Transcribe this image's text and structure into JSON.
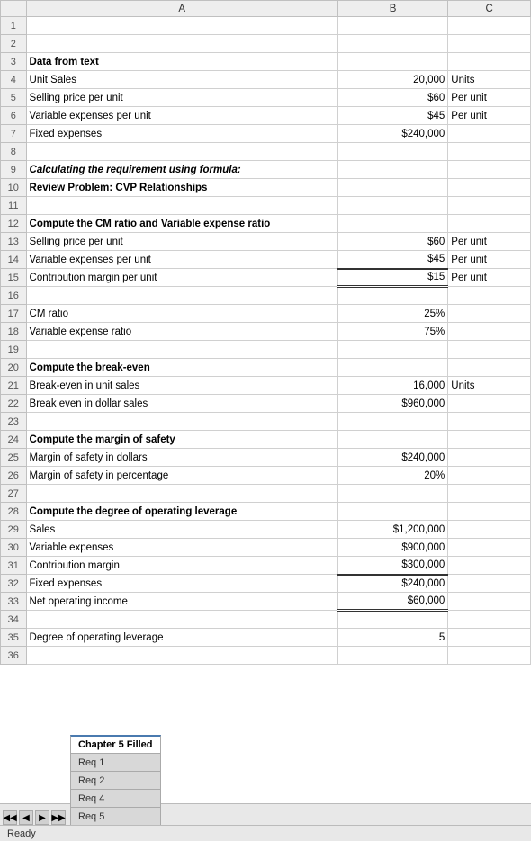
{
  "columns": [
    "",
    "A",
    "B",
    "C"
  ],
  "tabs": [
    {
      "label": "Chapter 5 Filled",
      "active": true
    },
    {
      "label": "Req 1",
      "active": false
    },
    {
      "label": "Req 2",
      "active": false
    },
    {
      "label": "Req 4",
      "active": false
    },
    {
      "label": "Req 5",
      "active": false
    }
  ],
  "status": "Ready",
  "rows": [
    {
      "num": "1",
      "a": "",
      "b": "",
      "c": "",
      "style_a": "",
      "style_b": "",
      "style_c": ""
    },
    {
      "num": "2",
      "a": "",
      "b": "",
      "c": "",
      "style_a": "",
      "style_b": "",
      "style_c": ""
    },
    {
      "num": "3",
      "a": "Data from text",
      "b": "",
      "c": "",
      "style_a": "cell-bold",
      "style_b": "",
      "style_c": ""
    },
    {
      "num": "4",
      "a": "Unit Sales",
      "b": "20,000",
      "c": "Units",
      "style_a": "",
      "style_b": "cell-right",
      "style_c": ""
    },
    {
      "num": "5",
      "a": "Selling price per unit",
      "b": "$60",
      "c": "Per unit",
      "style_a": "",
      "style_b": "cell-right",
      "style_c": ""
    },
    {
      "num": "6",
      "a": "Variable expenses per unit",
      "b": "$45",
      "c": "Per unit",
      "style_a": "",
      "style_b": "cell-right",
      "style_c": ""
    },
    {
      "num": "7",
      "a": "Fixed expenses",
      "b": "$240,000",
      "c": "",
      "style_a": "",
      "style_b": "cell-right",
      "style_c": ""
    },
    {
      "num": "8",
      "a": "",
      "b": "",
      "c": "",
      "style_a": "",
      "style_b": "",
      "style_c": ""
    },
    {
      "num": "9",
      "a": "Calculating the requirement using formula:",
      "b": "",
      "c": "",
      "style_a": "cell-bold-italic",
      "style_b": "",
      "style_c": ""
    },
    {
      "num": "10",
      "a": "Review Problem: CVP Relationships",
      "b": "",
      "c": "",
      "style_a": "cell-bold",
      "style_b": "",
      "style_c": ""
    },
    {
      "num": "11",
      "a": "",
      "b": "",
      "c": "",
      "style_a": "",
      "style_b": "",
      "style_c": ""
    },
    {
      "num": "12",
      "a": "Compute the CM ratio and Variable expense ratio",
      "b": "",
      "c": "",
      "style_a": "cell-bold",
      "style_b": "",
      "style_c": ""
    },
    {
      "num": "13",
      "a": "Selling price per unit",
      "b": "$60",
      "c": "Per unit",
      "style_a": "",
      "style_b": "cell-right",
      "style_c": ""
    },
    {
      "num": "14",
      "a": "Variable expenses per unit",
      "b": "$45",
      "c": "Per unit",
      "style_a": "",
      "style_b": "cell-right underline-bottom",
      "style_c": ""
    },
    {
      "num": "15",
      "a": "Contribution margin per unit",
      "b": "$15",
      "c": "Per unit",
      "style_a": "",
      "style_b": "cell-right underline-double-bottom",
      "style_c": ""
    },
    {
      "num": "16",
      "a": "",
      "b": "",
      "c": "",
      "style_a": "",
      "style_b": "",
      "style_c": ""
    },
    {
      "num": "17",
      "a": "CM ratio",
      "b": "25%",
      "c": "",
      "style_a": "",
      "style_b": "cell-right",
      "style_c": ""
    },
    {
      "num": "18",
      "a": "Variable expense ratio",
      "b": "75%",
      "c": "",
      "style_a": "",
      "style_b": "cell-right",
      "style_c": ""
    },
    {
      "num": "19",
      "a": "",
      "b": "",
      "c": "",
      "style_a": "",
      "style_b": "",
      "style_c": ""
    },
    {
      "num": "20",
      "a": "Compute the break-even",
      "b": "",
      "c": "",
      "style_a": "cell-bold",
      "style_b": "",
      "style_c": ""
    },
    {
      "num": "21",
      "a": "Break-even in unit sales",
      "b": "16,000",
      "c": "Units",
      "style_a": "",
      "style_b": "cell-right",
      "style_c": ""
    },
    {
      "num": "22",
      "a": "Break even in dollar sales",
      "b": "$960,000",
      "c": "",
      "style_a": "",
      "style_b": "cell-right",
      "style_c": ""
    },
    {
      "num": "23",
      "a": "",
      "b": "",
      "c": "",
      "style_a": "",
      "style_b": "",
      "style_c": ""
    },
    {
      "num": "24",
      "a": "Compute the margin of safety",
      "b": "",
      "c": "",
      "style_a": "cell-bold",
      "style_b": "",
      "style_c": ""
    },
    {
      "num": "25",
      "a": "Margin of safety in dollars",
      "b": "$240,000",
      "c": "",
      "style_a": "",
      "style_b": "cell-right",
      "style_c": ""
    },
    {
      "num": "26",
      "a": "Margin of safety in percentage",
      "b": "20%",
      "c": "",
      "style_a": "",
      "style_b": "cell-right",
      "style_c": ""
    },
    {
      "num": "27",
      "a": "",
      "b": "",
      "c": "",
      "style_a": "",
      "style_b": "",
      "style_c": ""
    },
    {
      "num": "28",
      "a": "Compute the degree of operating leverage",
      "b": "",
      "c": "",
      "style_a": "cell-bold",
      "style_b": "",
      "style_c": ""
    },
    {
      "num": "29",
      "a": "Sales",
      "b": "$1,200,000",
      "c": "",
      "style_a": "",
      "style_b": "cell-right",
      "style_c": ""
    },
    {
      "num": "30",
      "a": "Variable expenses",
      "b": "$900,000",
      "c": "",
      "style_a": "",
      "style_b": "cell-right",
      "style_c": ""
    },
    {
      "num": "31",
      "a": "Contribution margin",
      "b": "$300,000",
      "c": "",
      "style_a": "",
      "style_b": "cell-right underline-bottom",
      "style_c": ""
    },
    {
      "num": "32",
      "a": "Fixed expenses",
      "b": "$240,000",
      "c": "",
      "style_a": "",
      "style_b": "cell-right",
      "style_c": ""
    },
    {
      "num": "33",
      "a": "Net operating income",
      "b": "$60,000",
      "c": "",
      "style_a": "",
      "style_b": "cell-right underline-double-bottom",
      "style_c": ""
    },
    {
      "num": "34",
      "a": "",
      "b": "",
      "c": "",
      "style_a": "",
      "style_b": "",
      "style_c": ""
    },
    {
      "num": "35",
      "a": "Degree of operating leverage",
      "b": "5",
      "c": "",
      "style_a": "",
      "style_b": "cell-right",
      "style_c": ""
    },
    {
      "num": "36",
      "a": "",
      "b": "",
      "c": "",
      "style_a": "",
      "style_b": "",
      "style_c": ""
    }
  ]
}
